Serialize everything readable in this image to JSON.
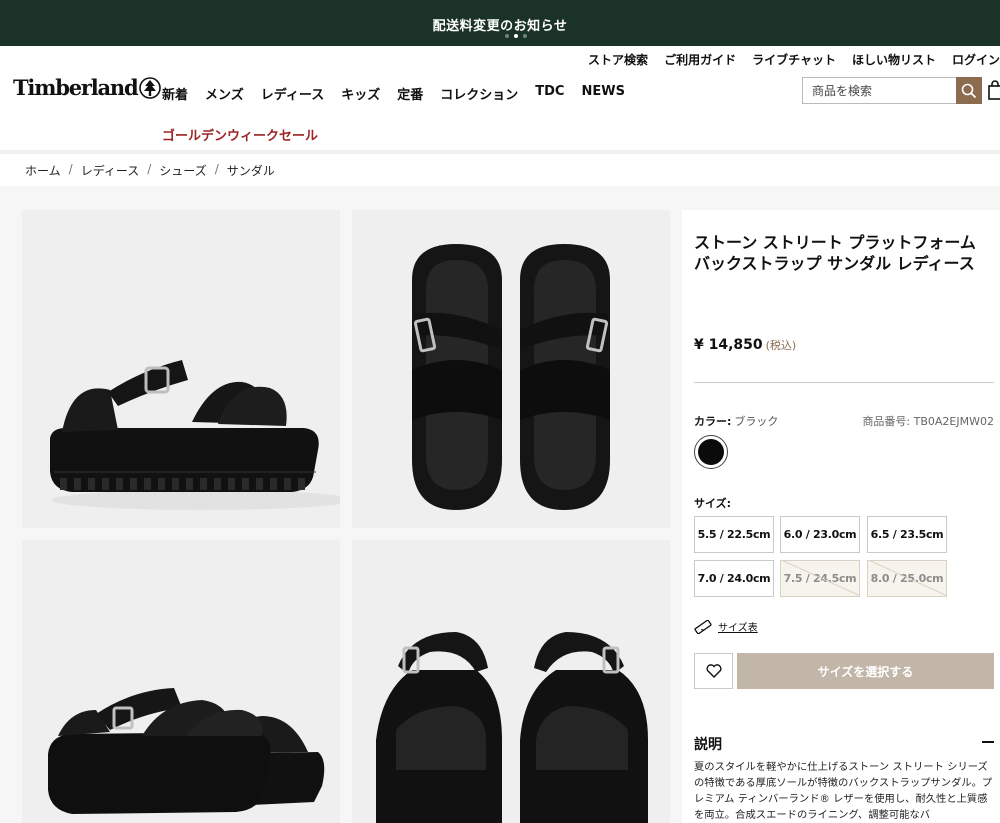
{
  "announcement": {
    "text": "配送料変更のお知らせ"
  },
  "utility_nav": [
    "ストア検索",
    "ご利用ガイド",
    "ライブチャット",
    "ほしい物リスト",
    "ログイン"
  ],
  "brand": {
    "name": "Timberland"
  },
  "main_nav": [
    "新着",
    "メンズ",
    "レディース",
    "キッズ",
    "定番",
    "コレクション",
    "TDC",
    "NEWS"
  ],
  "sale_link": "ゴールデンウィークセール",
  "search": {
    "placeholder": "商品を検索"
  },
  "breadcrumb": [
    "ホーム",
    "レディース",
    "シューズ",
    "サンダル"
  ],
  "product": {
    "title": "ストーン ストリート プラットフォーム バックストラップ サンダル レディース",
    "price": "¥ 14,850",
    "tax_note": "(税込)",
    "color_label": "カラー:",
    "color_value": "ブラック",
    "sku": "商品番号: TB0A2EJMW02",
    "size_label": "サイズ:",
    "sizes": [
      {
        "label": "5.5 / 22.5cm",
        "available": true
      },
      {
        "label": "6.0 / 23.0cm",
        "available": true
      },
      {
        "label": "6.5 / 23.5cm",
        "available": true
      },
      {
        "label": "7.0 / 24.0cm",
        "available": true
      },
      {
        "label": "7.5 / 24.5cm",
        "available": false
      },
      {
        "label": "8.0 / 25.0cm",
        "available": false
      }
    ],
    "size_guide": "サイズ表",
    "cta": "サイズを選択する",
    "description_heading": "説明",
    "description": "夏のスタイルを軽やかに仕上げるストーン ストリート シリーズの特徴である厚底ソールが特徴のバックストラップサンダル。プレミアム ティンバーランド® レザーを使用し、耐久性と上質感を両立。合成スエードのライニング、調整可能なバ"
  },
  "colors": {
    "announce_bg": "#1b3326",
    "accent": "#8b6c4f",
    "sale": "#9d2323",
    "cta": "#c2b6a8"
  }
}
